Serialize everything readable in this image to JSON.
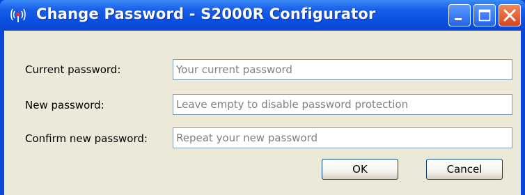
{
  "window": {
    "title": "Change Password - S2000R Configurator",
    "icon": "radio-antenna-icon",
    "controls": [
      "minimize-icon",
      "maximize-icon",
      "close-icon"
    ]
  },
  "form": {
    "current_password": {
      "label": "Current password:",
      "value": "",
      "placeholder": "Your current password"
    },
    "new_password": {
      "label": "New password:",
      "value": "",
      "placeholder": "Leave empty to disable password protection"
    },
    "confirm_password": {
      "label": "Confirm new password:",
      "value": "",
      "placeholder": "Repeat your new password"
    }
  },
  "buttons": {
    "ok_label": "OK",
    "cancel_label": "Cancel"
  },
  "colors": {
    "titlebar": "#0b4ee0",
    "dialog_bg": "#ece9d8",
    "close_button": "#d8451c"
  }
}
